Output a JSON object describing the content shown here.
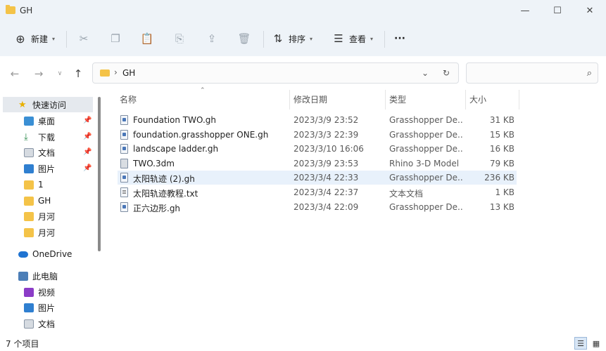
{
  "window": {
    "title": "GH",
    "minimize": "—",
    "maximize": "☐",
    "close": "✕"
  },
  "toolbar": {
    "new_label": "新建",
    "sort_label": "排序",
    "view_label": "查看",
    "more": "···"
  },
  "address": {
    "path": "GH"
  },
  "sidebar": {
    "items": [
      {
        "label": "快速访问",
        "icon": "star-icon",
        "pinned": false
      },
      {
        "label": "桌面",
        "icon": "desktop-icon",
        "pinned": true
      },
      {
        "label": "下载",
        "icon": "download-icon",
        "pinned": true
      },
      {
        "label": "文档",
        "icon": "document-icon",
        "pinned": true
      },
      {
        "label": "图片",
        "icon": "picture-icon",
        "pinned": true
      },
      {
        "label": "1",
        "icon": "folder-icon",
        "pinned": false
      },
      {
        "label": "GH",
        "icon": "folder-icon",
        "pinned": false
      },
      {
        "label": "月河",
        "icon": "folder-icon",
        "pinned": false
      },
      {
        "label": "月河",
        "icon": "folder-icon",
        "pinned": false
      },
      {
        "label": "OneDrive",
        "icon": "cloud-icon",
        "pinned": false
      },
      {
        "label": "此电脑",
        "icon": "computer-icon",
        "pinned": false
      },
      {
        "label": "视频",
        "icon": "video-icon",
        "pinned": false
      },
      {
        "label": "图片",
        "icon": "picture-icon",
        "pinned": false
      },
      {
        "label": "文档",
        "icon": "document-icon",
        "pinned": false
      }
    ]
  },
  "columns": {
    "name": "名称",
    "date": "修改日期",
    "type": "类型",
    "size": "大小"
  },
  "files": [
    {
      "name": "Foundation TWO.gh",
      "date": "2023/3/9 23:52",
      "type": "Grasshopper De...",
      "size": "31 KB",
      "icon": "gh"
    },
    {
      "name": "foundation.grasshopper ONE.gh",
      "date": "2023/3/3 22:39",
      "type": "Grasshopper De...",
      "size": "15 KB",
      "icon": "gh"
    },
    {
      "name": "landscape ladder.gh",
      "date": "2023/3/10 16:06",
      "type": "Grasshopper De...",
      "size": "16 KB",
      "icon": "gh"
    },
    {
      "name": "TWO.3dm",
      "date": "2023/3/9 23:53",
      "type": "Rhino 3-D Model",
      "size": "79 KB",
      "icon": "dm"
    },
    {
      "name": "太阳轨迹 (2).gh",
      "date": "2023/3/4 22:33",
      "type": "Grasshopper De...",
      "size": "236 KB",
      "icon": "gh"
    },
    {
      "name": "太阳轨迹教程.txt",
      "date": "2023/3/4 22:37",
      "type": "文本文档",
      "size": "1 KB",
      "icon": "txt"
    },
    {
      "name": "正六边形.gh",
      "date": "2023/3/4 22:09",
      "type": "Grasshopper De...",
      "size": "13 KB",
      "icon": "gh"
    }
  ],
  "status": {
    "item_count": "7 个项目"
  }
}
